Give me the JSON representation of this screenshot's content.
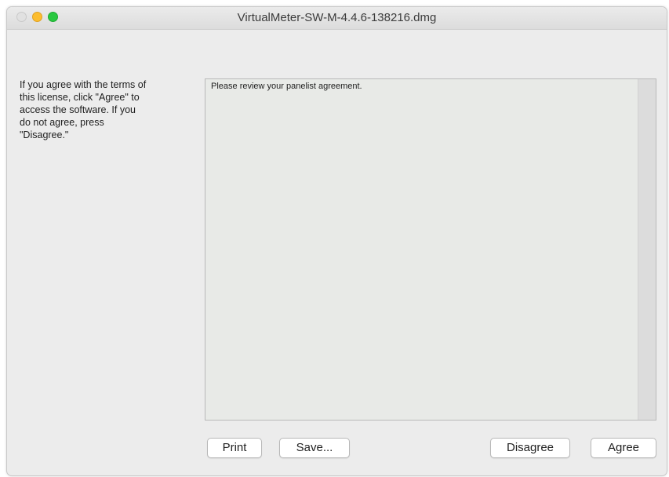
{
  "window": {
    "title": "VirtualMeter-SW-M-4.4.6-138216.dmg"
  },
  "instructions": "If you agree with the terms of\nthis license, click \"Agree\" to\naccess the software.  If you\ndo not agree, press\n\"Disagree.\"",
  "license": {
    "text": "Please review your panelist agreement."
  },
  "buttons": {
    "print": "Print",
    "save": "Save...",
    "disagree": "Disagree",
    "agree": "Agree"
  },
  "colors": {
    "close": "#e1e1e1",
    "minimize": "#fcbd2e",
    "zoom": "#29c840"
  }
}
